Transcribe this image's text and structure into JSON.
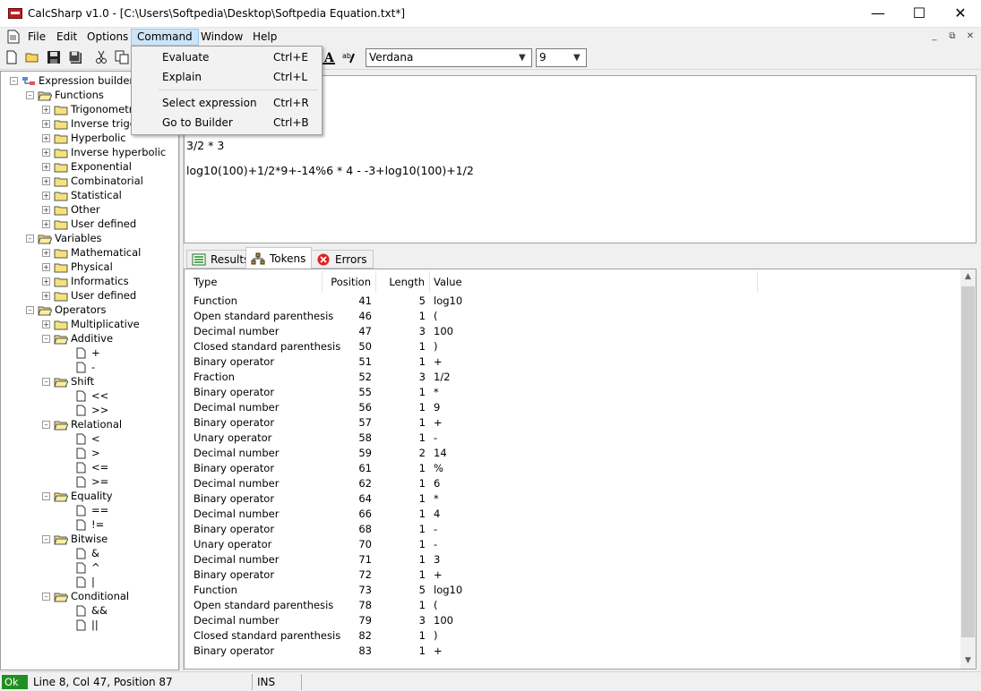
{
  "window": {
    "title": "CalcSharp v1.0 - [C:\\Users\\Softpedia\\Desktop\\Softpedia Equation.txt*]"
  },
  "menu": {
    "items": [
      "File",
      "Edit",
      "Options",
      "Command",
      "Window",
      "Help"
    ],
    "active": "Command"
  },
  "command_menu": {
    "items": [
      {
        "label": "Evaluate",
        "shortcut": "Ctrl+E"
      },
      {
        "label": "Explain",
        "shortcut": "Ctrl+L"
      },
      {
        "label": "Select expression",
        "shortcut": "Ctrl+R"
      },
      {
        "label": "Go to Builder",
        "shortcut": "Ctrl+B"
      }
    ]
  },
  "toolbar": {
    "font": "Verdana",
    "size": "9"
  },
  "tree": {
    "root": "Expression builder",
    "functions": {
      "label": "Functions",
      "items": [
        "Trigonometric",
        "Inverse trigon",
        "Hyperbolic",
        "Inverse hyperbolic",
        "Exponential",
        "Combinatorial",
        "Statistical",
        "Other",
        "User defined"
      ]
    },
    "variables": {
      "label": "Variables",
      "items": [
        "Mathematical",
        "Physical",
        "Informatics",
        "User defined"
      ]
    },
    "operators": {
      "label": "Operators",
      "multiplicative": "Multiplicative",
      "additive": {
        "label": "Additive",
        "items": [
          "+",
          "-"
        ]
      },
      "shift": {
        "label": "Shift",
        "items": [
          "<<",
          ">>"
        ]
      },
      "relational": {
        "label": "Relational",
        "items": [
          "<",
          ">",
          "<=",
          ">="
        ]
      },
      "equality": {
        "label": "Equality",
        "items": [
          "==",
          "!="
        ]
      },
      "bitwise": {
        "label": "Bitwise",
        "items": [
          "&",
          "^",
          "|"
        ]
      },
      "conditional": {
        "label": "Conditional",
        "items": [
          "&&",
          "||"
        ]
      }
    }
  },
  "editor": {
    "lines": [
      "3/2 * 3",
      "log10(100)+1/2*9+-14%6 * 4 - -3+log10(100)+1/2"
    ]
  },
  "tabs": [
    "Results",
    "Tokens",
    "Errors"
  ],
  "tokens": {
    "columns": [
      "Type",
      "Position",
      "Length",
      "Value"
    ],
    "rows": [
      [
        "Function",
        "41",
        "5",
        "log10"
      ],
      [
        "Open standard parenthesis",
        "46",
        "1",
        "("
      ],
      [
        "Decimal number",
        "47",
        "3",
        "100"
      ],
      [
        "Closed standard parenthesis",
        "50",
        "1",
        ")"
      ],
      [
        "Binary operator",
        "51",
        "1",
        "+"
      ],
      [
        "Fraction",
        "52",
        "3",
        "1/2"
      ],
      [
        "Binary operator",
        "55",
        "1",
        "*"
      ],
      [
        "Decimal number",
        "56",
        "1",
        "9"
      ],
      [
        "Binary operator",
        "57",
        "1",
        "+"
      ],
      [
        "Unary operator",
        "58",
        "1",
        "-"
      ],
      [
        "Decimal number",
        "59",
        "2",
        "14"
      ],
      [
        "Binary operator",
        "61",
        "1",
        "%"
      ],
      [
        "Decimal number",
        "62",
        "1",
        "6"
      ],
      [
        "Binary operator",
        "64",
        "1",
        "*"
      ],
      [
        "Decimal number",
        "66",
        "1",
        "4"
      ],
      [
        "Binary operator",
        "68",
        "1",
        "-"
      ],
      [
        "Unary operator",
        "70",
        "1",
        "-"
      ],
      [
        "Decimal number",
        "71",
        "1",
        "3"
      ],
      [
        "Binary operator",
        "72",
        "1",
        "+"
      ],
      [
        "Function",
        "73",
        "5",
        "log10"
      ],
      [
        "Open standard parenthesis",
        "78",
        "1",
        "("
      ],
      [
        "Decimal number",
        "79",
        "3",
        "100"
      ],
      [
        "Closed standard parenthesis",
        "82",
        "1",
        ")"
      ],
      [
        "Binary operator",
        "83",
        "1",
        "+"
      ]
    ]
  },
  "status": {
    "state": "Ok",
    "position": "Line 8, Col 47, Position 87",
    "mode": "INS"
  },
  "colors": {
    "accent": "#cce4f7",
    "ok": "#1f8f1f",
    "folder": "#f6e27a"
  }
}
